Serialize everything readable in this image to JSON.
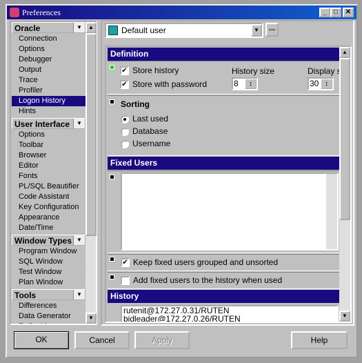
{
  "window": {
    "title": "Preferences",
    "minimize": "_",
    "maximize": "□",
    "close": "✕"
  },
  "sidebar": {
    "groups": [
      {
        "label": "Oracle",
        "items": [
          "Connection",
          "Options",
          "Debugger",
          "Output",
          "Trace",
          "Profiler",
          "Logon History",
          "Hints"
        ]
      },
      {
        "label": "User Interface",
        "items": [
          "Options",
          "Toolbar",
          "Browser",
          "Editor",
          "Fonts",
          "PL/SQL Beautifier",
          "Code Assistant",
          "Key Configuration",
          "Appearance",
          "Date/Time"
        ]
      },
      {
        "label": "Window Types",
        "items": [
          "Program Window",
          "SQL Window",
          "Test Window",
          "Plan Window"
        ]
      },
      {
        "label": "Tools",
        "items": [
          "Differences",
          "Data Generator",
          "To Do List"
        ]
      }
    ],
    "selected": "Logon History"
  },
  "user_select": {
    "value": "Default user",
    "more_label": "..."
  },
  "definition": {
    "header": "Definition",
    "store_history": {
      "label": "Store history",
      "checked": true
    },
    "store_with_password": {
      "label": "Store with password",
      "checked": true
    },
    "history_size": {
      "label": "History size",
      "value": "8"
    },
    "display_size": {
      "label": "Display siz",
      "value": "30"
    }
  },
  "sorting": {
    "label": "Sorting",
    "options": [
      "Last used",
      "Database",
      "Username"
    ],
    "selected": "Last used"
  },
  "fixed_users": {
    "header": "Fixed Users",
    "keep_grouped": {
      "label": "Keep fixed users grouped and unsorted",
      "checked": true
    },
    "add_to_history": {
      "label": "Add fixed users to the history when used",
      "checked": false
    }
  },
  "history": {
    "header": "History",
    "entries": [
      "rutenit@172.27.0.31/RUTEN",
      "bidleader@172.27.0.26/RUTEN"
    ]
  },
  "buttons": {
    "ok": "OK",
    "cancel": "Cancel",
    "apply": "Apply",
    "help": "Help"
  },
  "colors": {
    "accent": "#1a0a80",
    "status_green": "#00e000"
  }
}
